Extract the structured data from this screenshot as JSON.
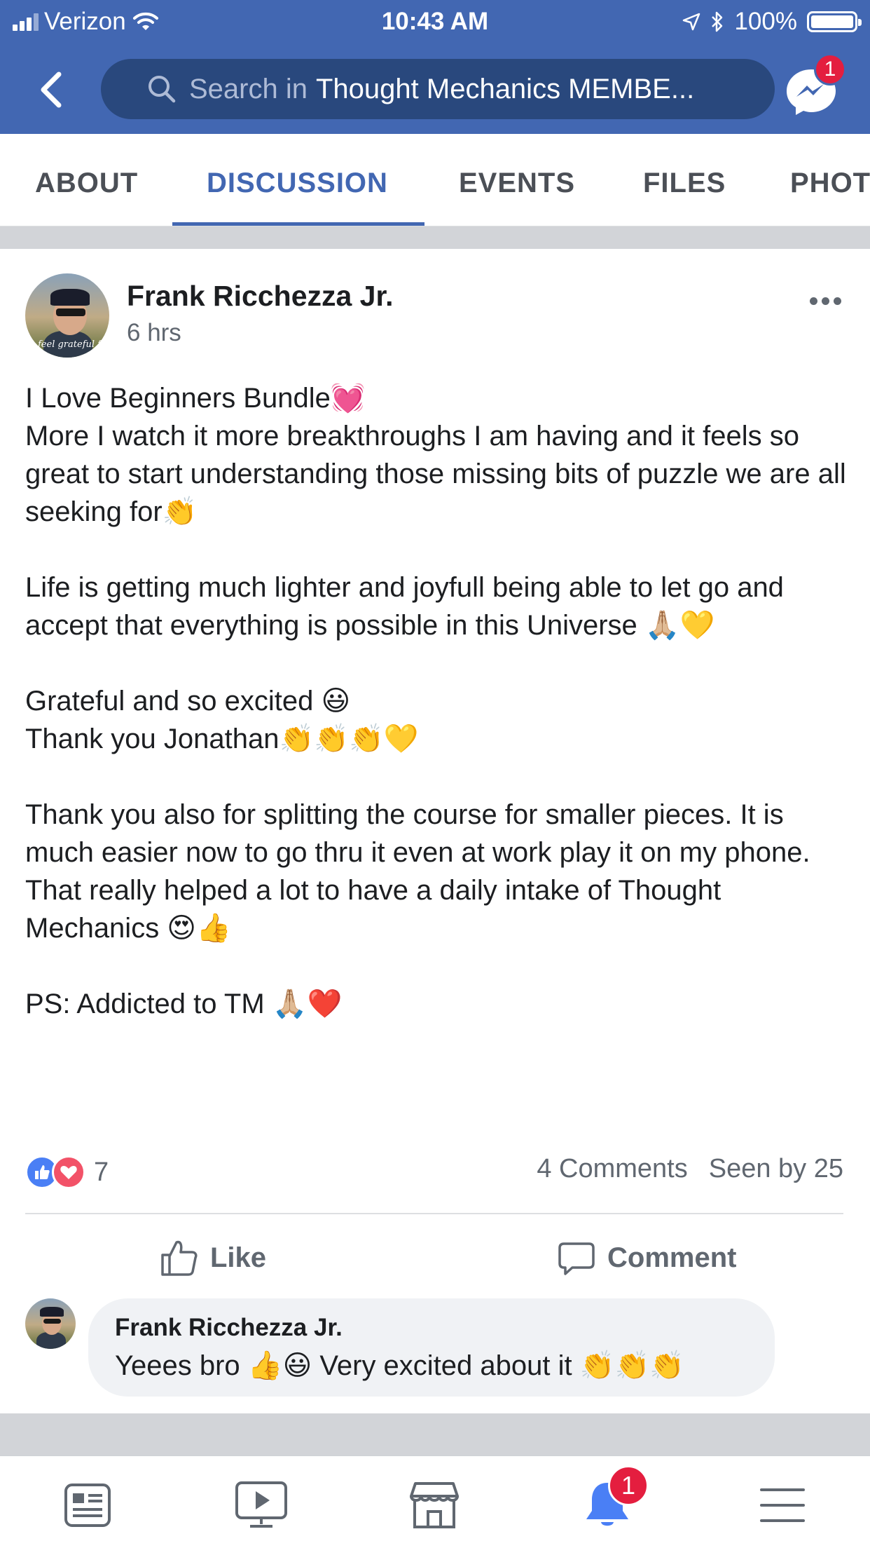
{
  "status_bar": {
    "carrier": "Verizon",
    "time": "10:43 AM",
    "battery": "100%"
  },
  "header": {
    "search_placeholder": "Search in",
    "search_group": "Thought Mechanics MEMBE...",
    "messenger_badge": "1"
  },
  "tabs": [
    {
      "label": "ABOUT"
    },
    {
      "label": "DISCUSSION"
    },
    {
      "label": "EVENTS"
    },
    {
      "label": "FILES"
    },
    {
      "label": "PHOT"
    }
  ],
  "active_tab": "DISCUSSION",
  "post": {
    "author": "Frank Ricchezza Jr.",
    "time": "6 hrs",
    "avatar_signature": "feel grateful feel",
    "lines": {
      "l1": "I Love Beginners Bundle💓",
      "l2": "More I watch it more breakthroughs I am having and it feels so great to start understanding those missing bits of puzzle we are all seeking for👏",
      "l3": "Life is getting much lighter and joyfull being able to let go and accept that everything is possible in this Universe 🙏🏼💛",
      "l4": "Grateful and so excited 😃",
      "l5": "Thank you Jonathan👏👏👏💛",
      "l6": "Thank you also for splitting the course for smaller pieces. It is much easier now to go thru it even at work play it on my phone.",
      "l7": "That really helped a lot to have a daily intake of Thought Mechanics 😍👍",
      "l8": "PS: Addicted to TM 🙏🏼❤️"
    },
    "reaction_count": "7",
    "comments": "4 Comments",
    "seen_by": "Seen by 25",
    "like_label": "Like",
    "comment_label": "Comment"
  },
  "comment": {
    "author": "Frank Ricchezza Jr.",
    "text": "Yeees bro 👍😃 Very excited about it 👏👏👏"
  },
  "bottom_nav": {
    "icons": [
      "news-feed-icon",
      "watch-icon",
      "marketplace-icon",
      "notifications-icon",
      "menu-icon"
    ],
    "notifications_badge": "1"
  },
  "colors": {
    "brand_blue": "#4267b2",
    "search_bg": "#29487d",
    "badge_red": "#e41e3f",
    "secondary_text": "#606770"
  }
}
